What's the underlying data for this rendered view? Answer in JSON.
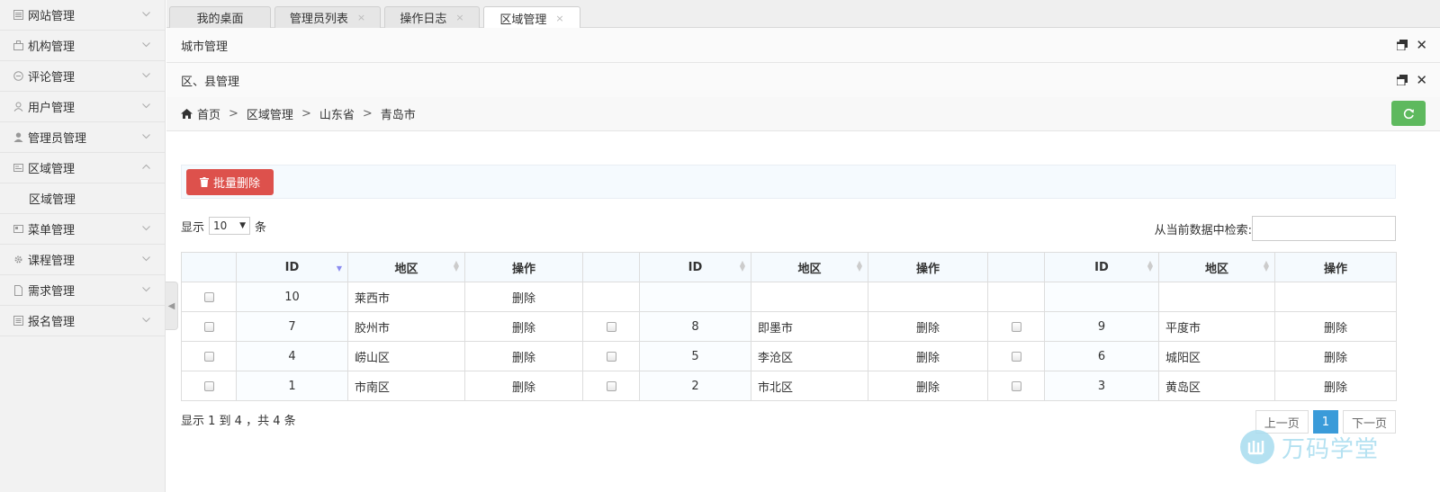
{
  "sidebar": {
    "items": [
      {
        "label": "网站管理",
        "icon": "website-icon"
      },
      {
        "label": "机构管理",
        "icon": "organization-icon"
      },
      {
        "label": "评论管理",
        "icon": "comment-icon"
      },
      {
        "label": "用户管理",
        "icon": "user-icon"
      },
      {
        "label": "管理员管理",
        "icon": "admin-icon"
      },
      {
        "label": "区域管理",
        "icon": "region-icon",
        "expanded": true,
        "sub": "区域管理"
      },
      {
        "label": "菜单管理",
        "icon": "menu-icon"
      },
      {
        "label": "课程管理",
        "icon": "course-icon"
      },
      {
        "label": "需求管理",
        "icon": "document-icon"
      },
      {
        "label": "报名管理",
        "icon": "signup-icon"
      }
    ]
  },
  "tabs": [
    {
      "label": "我的桌面"
    },
    {
      "label": "管理员列表",
      "close": "×"
    },
    {
      "label": "操作日志",
      "close": "×"
    },
    {
      "label": "区域管理",
      "close": "×",
      "active": true
    }
  ],
  "panels": {
    "city": "城市管理",
    "district": "区、县管理"
  },
  "breadcrumb": {
    "home": "首页",
    "sep": ">",
    "level1": "区域管理",
    "level2": "山东省",
    "level3": "青岛市"
  },
  "toolbar": {
    "batch_delete": "批量删除"
  },
  "length": {
    "prefix": "显示",
    "value": "10",
    "suffix": "条"
  },
  "search": {
    "label": "从当前数据中检索:",
    "value": ""
  },
  "table": {
    "headers": {
      "id": "ID",
      "region": "地区",
      "action": "操作"
    },
    "rows": [
      [
        {
          "id": "10",
          "region": "莱西市",
          "action": "删除"
        }
      ],
      [
        {
          "id": "7",
          "region": "胶州市",
          "action": "删除"
        },
        {
          "id": "8",
          "region": "即墨市",
          "action": "删除"
        },
        {
          "id": "9",
          "region": "平度市",
          "action": "删除"
        }
      ],
      [
        {
          "id": "4",
          "region": "崂山区",
          "action": "删除"
        },
        {
          "id": "5",
          "region": "李沧区",
          "action": "删除"
        },
        {
          "id": "6",
          "region": "城阳区",
          "action": "删除"
        }
      ],
      [
        {
          "id": "1",
          "region": "市南区",
          "action": "删除"
        },
        {
          "id": "2",
          "region": "市北区",
          "action": "删除"
        },
        {
          "id": "3",
          "region": "黄岛区",
          "action": "删除"
        }
      ]
    ]
  },
  "info": "显示 1 到 4 ，共 4 条",
  "pager": {
    "prev": "上一页",
    "current": "1",
    "next": "下一页"
  },
  "watermark": "万码学堂",
  "colors": {
    "danger": "#dd514c",
    "success": "#5eb95e",
    "primary": "#3a9bd9"
  }
}
